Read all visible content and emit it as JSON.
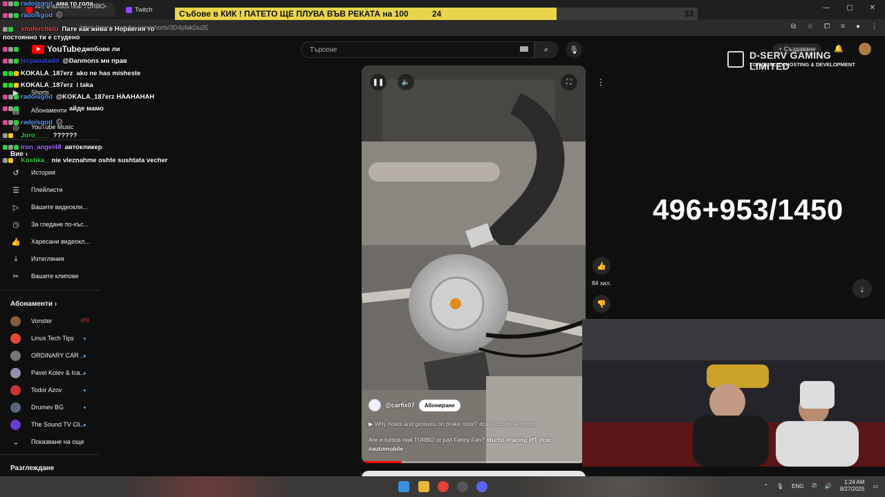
{
  "browser": {
    "tabs": [
      {
        "label": "Are e-turbos real TURBO-o"
      },
      {
        "label": "Twitch"
      }
    ],
    "url": "https://www.youtube.com/shorts/3D4pfakDu2E"
  },
  "overlay_bar": {
    "text": "Събове в КИК ! ПАТЕТО ЩЕ ПЛУВА ВЪВ РЕКАТА на 100",
    "left_value": "24",
    "right_value": "33",
    "progress_fraction": 0.73
  },
  "youtube": {
    "logo_text": "YouTube",
    "search_placeholder": "Търсене",
    "create_label": "Създаване",
    "sidebar": {
      "main_items": [
        {
          "label": "Shorts",
          "icon": "shorts-icon"
        },
        {
          "label": "Абонаменти",
          "icon": "subscriptions-icon"
        },
        {
          "label": "YouTube Music",
          "icon": "music-icon"
        }
      ],
      "you_heading": "Вие",
      "you_items": [
        {
          "label": "История",
          "icon": "history-icon"
        },
        {
          "label": "Плейлисти",
          "icon": "playlist-icon"
        },
        {
          "label": "Вашите видеокли...",
          "icon": "video-icon"
        },
        {
          "label": "За гледане по-къс...",
          "icon": "clock-icon"
        },
        {
          "label": "Харесани видеокл...",
          "icon": "thumbs-up-icon"
        },
        {
          "label": "Изтегляния",
          "icon": "download-icon"
        },
        {
          "label": "Вашите клипове",
          "icon": "scissors-icon"
        }
      ],
      "subscriptions_heading": "Абонаменти",
      "channels": [
        {
          "label": "Vonster",
          "color": "#8a5a3a",
          "live": true
        },
        {
          "label": "Linus Tech Tips",
          "color": "#e8453c",
          "live": false
        },
        {
          "label": "ORDINARY CAR ...",
          "color": "#777777",
          "live": false
        },
        {
          "label": "Pavel Kolev & Ica...",
          "color": "#9b8fb0",
          "live": false
        },
        {
          "label": "Todor Azov",
          "color": "#cc3333",
          "live": false
        },
        {
          "label": "Drumev BG",
          "color": "#556677",
          "live": false
        },
        {
          "label": "The Sound TV Cli...",
          "color": "#6b3bd6",
          "live": false
        }
      ],
      "show_more": "Показване на още",
      "browse_heading": "Разглеждане"
    },
    "short": {
      "channel": "@carfix07",
      "subscribe_label": "Абониране",
      "related": "Why holes and grooves on brake rotor? #carfacts #brakerotors",
      "title": "Are e-turbos real TURBO or just Fancy Fan? ",
      "title_tags": "#turbo #racing #f1 #car #automobile",
      "likes": "84 хил.",
      "progress_fraction": 0.18
    }
  },
  "chat": [
    {
      "user": "radoisgod",
      "text": "ама то гола",
      "color": "#5b9bff"
    },
    {
      "user": "radoisgod",
      "text": "",
      "color": "#5b9bff"
    },
    {
      "user": "shoferchetu",
      "text": "Пате как жива е Норвегия то постоянно ти е студено",
      "color": "#ff4444"
    },
    {
      "user": "",
      "text": "джобове ли",
      "color": "#5b9bff"
    },
    {
      "user": "",
      "text": "@Danmons мн прав",
      "color": "#5b9bff"
    },
    {
      "user": "KOKALA_187erz",
      "text": "ako ne has misheste",
      "color": "#ffffff"
    },
    {
      "user": "KOKALA_187erz",
      "text": "i taka",
      "color": "#ffffff"
    },
    {
      "user": "radoisgod",
      "text": "@KOKALA_187erz HAAHAHAH",
      "color": "#5b9bff"
    },
    {
      "user": "",
      "text": "айде мамо",
      "color": "#5b9bff"
    },
    {
      "user": "radoisgod",
      "text": "",
      "color": "#5b9bff"
    },
    {
      "user": "Joro____",
      "text": "??????",
      "color": "#2ecc40"
    },
    {
      "user": "iron_angel48",
      "text": "автокликер",
      "color": "#a66bff"
    },
    {
      "user": "Kostika_",
      "text": "nie vleznahme oshte sushtata vecher",
      "color": "#2ecc40"
    }
  ],
  "stream": {
    "sponsor_name": "D-SERV GAMING LIMITED",
    "sponsor_tagline": "TOP QUALITY HOSTING & DEVELOPMENT",
    "counter": "496+953/1450"
  },
  "taskbar": {
    "language": "ENG",
    "time": "1:24 AM",
    "date": "8/27/2025"
  }
}
